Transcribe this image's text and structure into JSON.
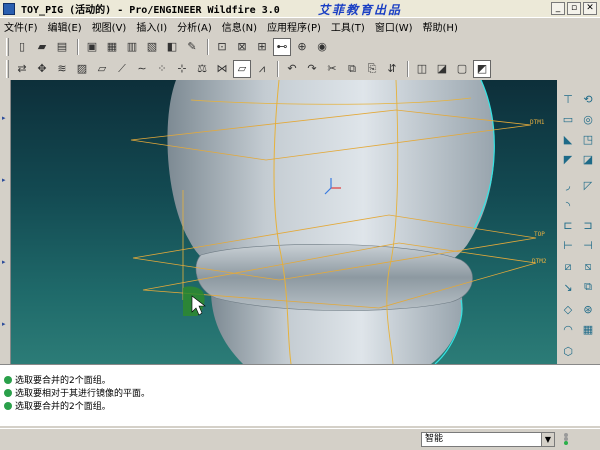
{
  "window": {
    "title": "TOY_PIG (活动的) - Pro/ENGINEER Wildfire 3.0",
    "watermark": "艾菲教育出品",
    "controls": {
      "minimize": "_",
      "restore": "▫",
      "close": "✕"
    }
  },
  "menubar": {
    "items": [
      "文件(F)",
      "编辑(E)",
      "视图(V)",
      "插入(I)",
      "分析(A)",
      "信息(N)",
      "应用程序(P)",
      "工具(T)",
      "窗口(W)",
      "帮助(H)"
    ]
  },
  "toolbar_top": {
    "icons": [
      "new-icon",
      "open-icon",
      "open-recent-icon",
      "save-icon",
      "save-copy-icon",
      "print-icon",
      "print-setup-icon",
      "paste-icon",
      "brush-icon",
      "regenerate-icon",
      "close-window-icon",
      "window-activate-icon",
      "datum-axis-display-icon",
      "zoom-box-icon",
      "color-appearance-icon"
    ]
  },
  "toolbar_second": {
    "icons": [
      "orient-icon",
      "spin-center-icon",
      "layers-icon",
      "shading-icon",
      "datum-plane-icon",
      "datum-axis-icon",
      "sketched-curve-icon",
      "datum-point-icon",
      "coordinate-system-icon",
      "analysis-icon",
      "trim-icon",
      "sketch-icon",
      "mirror-icon",
      "undo-icon",
      "redo-icon",
      "cut-icon",
      "copy-icon",
      "paste-special-icon",
      "regenerate-model-icon",
      "wireframe-icon",
      "hidden-line-icon",
      "no-hidden-icon",
      "shaded-icon"
    ]
  },
  "viewport": {
    "datum_planes": [
      "DTM1",
      "TOP",
      "DTM2"
    ]
  },
  "right_toolbar": {
    "icons": [
      "extrude-icon",
      "revolve-icon",
      "boundary-blend-icon",
      "variable-section-sweep-icon",
      "hole-icon",
      "shell-icon",
      "rib-icon",
      "draft-icon",
      "round-icon",
      "chamfer-icon",
      "pattern-icon",
      "merge-icon",
      "trim-quilt-icon",
      "offset-icon",
      "thicken-icon",
      "solidify-icon",
      "style-icon",
      "warp-icon",
      "copy-geometry-icon",
      "mirror-feature-icon",
      "intersect-icon",
      "project-icon",
      "fill-icon",
      "extend-icon",
      "curve-from-equation-icon"
    ]
  },
  "messages": [
    "选取要合并的2个面组。",
    "选取要相对于其进行镜像的平面。",
    "选取要合并的2个面组。"
  ],
  "statusbar": {
    "filter_value": "智能"
  }
}
